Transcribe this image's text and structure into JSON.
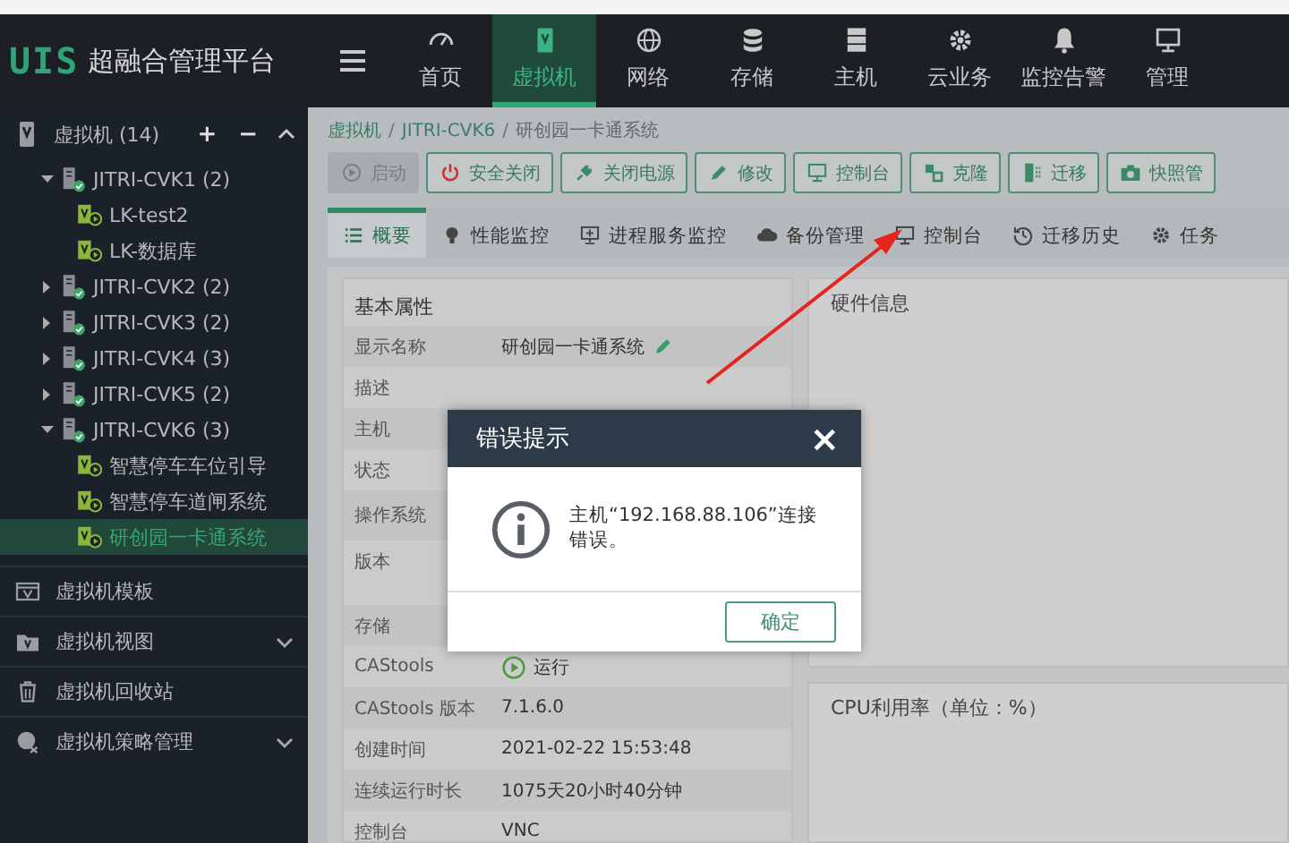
{
  "app": {
    "logo": "UIS",
    "title": "超融合管理平台"
  },
  "nav": [
    {
      "label": "首页",
      "kind": "gauge",
      "selected": false
    },
    {
      "label": "虚拟机",
      "kind": "vm",
      "selected": true
    },
    {
      "label": "网络",
      "kind": "globe",
      "selected": false
    },
    {
      "label": "存储",
      "kind": "database",
      "selected": false
    },
    {
      "label": "主机",
      "kind": "server",
      "selected": false
    },
    {
      "label": "云业务",
      "kind": "gear",
      "selected": false
    },
    {
      "label": "监控告警",
      "kind": "bell",
      "selected": false
    },
    {
      "label": "管理",
      "kind": "monitor",
      "selected": false
    }
  ],
  "sidebar": {
    "root": {
      "label": "虚拟机 (14)",
      "actions": [
        "+",
        "−"
      ]
    },
    "tree": [
      {
        "label": "JITRI-CVK1 (2)",
        "selected": false,
        "expanded": true,
        "children": [
          {
            "label": "LK-test2",
            "selected": false
          },
          {
            "label": "LK-数据库",
            "selected": false
          }
        ]
      },
      {
        "label": "JITRI-CVK2 (2)",
        "selected": false,
        "expanded": false
      },
      {
        "label": "JITRI-CVK3 (2)",
        "selected": false,
        "expanded": false
      },
      {
        "label": "JITRI-CVK4 (3)",
        "selected": false,
        "expanded": false
      },
      {
        "label": "JITRI-CVK5 (2)",
        "selected": false,
        "expanded": false
      },
      {
        "label": "JITRI-CVK6 (3)",
        "selected": false,
        "expanded": true,
        "children": [
          {
            "label": "智慧停车车位引导",
            "selected": false
          },
          {
            "label": "智慧停车道闸系统",
            "selected": false
          },
          {
            "label": "研创园一卡通系统",
            "selected": true
          }
        ]
      }
    ],
    "sections": [
      {
        "label": "虚拟机模板",
        "kind": "template"
      },
      {
        "label": "虚拟机视图",
        "kind": "folder"
      },
      {
        "label": "虚拟机回收站",
        "kind": "trash"
      },
      {
        "label": "虚拟机策略管理",
        "kind": "policy"
      }
    ]
  },
  "breadcrumb": {
    "separator": "/",
    "items": [
      "虚拟机",
      "JITRI-CVK6",
      "研创园一卡通系统"
    ]
  },
  "actions": [
    {
      "label": "启动",
      "kind": "play",
      "disabled": true
    },
    {
      "label": "安全关闭",
      "kind": "power",
      "disabled": false
    },
    {
      "label": "关闭电源",
      "kind": "plug",
      "disabled": false
    },
    {
      "label": "修改",
      "kind": "pencil",
      "disabled": false
    },
    {
      "label": "控制台",
      "kind": "monitor",
      "disabled": false
    },
    {
      "label": "克隆",
      "kind": "clone",
      "disabled": false
    },
    {
      "label": "迁移",
      "kind": "migrate",
      "disabled": false
    },
    {
      "label": "快照管",
      "kind": "camera",
      "disabled": false
    }
  ],
  "tabs": [
    {
      "label": "概要",
      "kind": "list",
      "selected": true
    },
    {
      "label": "性能监控",
      "kind": "bulb",
      "selected": false
    },
    {
      "label": "进程服务监控",
      "kind": "screen",
      "selected": false
    },
    {
      "label": "备份管理",
      "kind": "cloud",
      "selected": false
    },
    {
      "label": "控制台",
      "kind": "monitor",
      "selected": false
    },
    {
      "label": "迁移历史",
      "kind": "history",
      "selected": false
    },
    {
      "label": "任务",
      "kind": "gear",
      "selected": false
    }
  ],
  "basic": {
    "title": "基本属性",
    "rows": [
      {
        "label": "显示名称",
        "value": "研创园一卡通系统",
        "editable": true
      },
      {
        "label": "描述"
      },
      {
        "label": "主机"
      },
      {
        "label": "状态"
      },
      {
        "label": "操作系统"
      },
      {
        "label": "版本"
      },
      {
        "label": "存储"
      },
      {
        "label": "CAStools",
        "value": "运行",
        "kind": "status"
      },
      {
        "label": "CAStools 版本",
        "value": "7.1.6.0"
      },
      {
        "label": "创建时间",
        "value": "2021-02-22 15:53:48"
      },
      {
        "label": "连续运行时长",
        "value": "1075天20小时40分钟"
      },
      {
        "label": "控制台",
        "value": "VNC"
      }
    ]
  },
  "hardware": {
    "title": "硬件信息"
  },
  "cpu": {
    "title": "CPU利用率（单位：%）"
  },
  "dialog": {
    "title": "错误提示",
    "close": "×",
    "message": "主机“192.168.88.106”连接错误。",
    "button": "确定"
  }
}
